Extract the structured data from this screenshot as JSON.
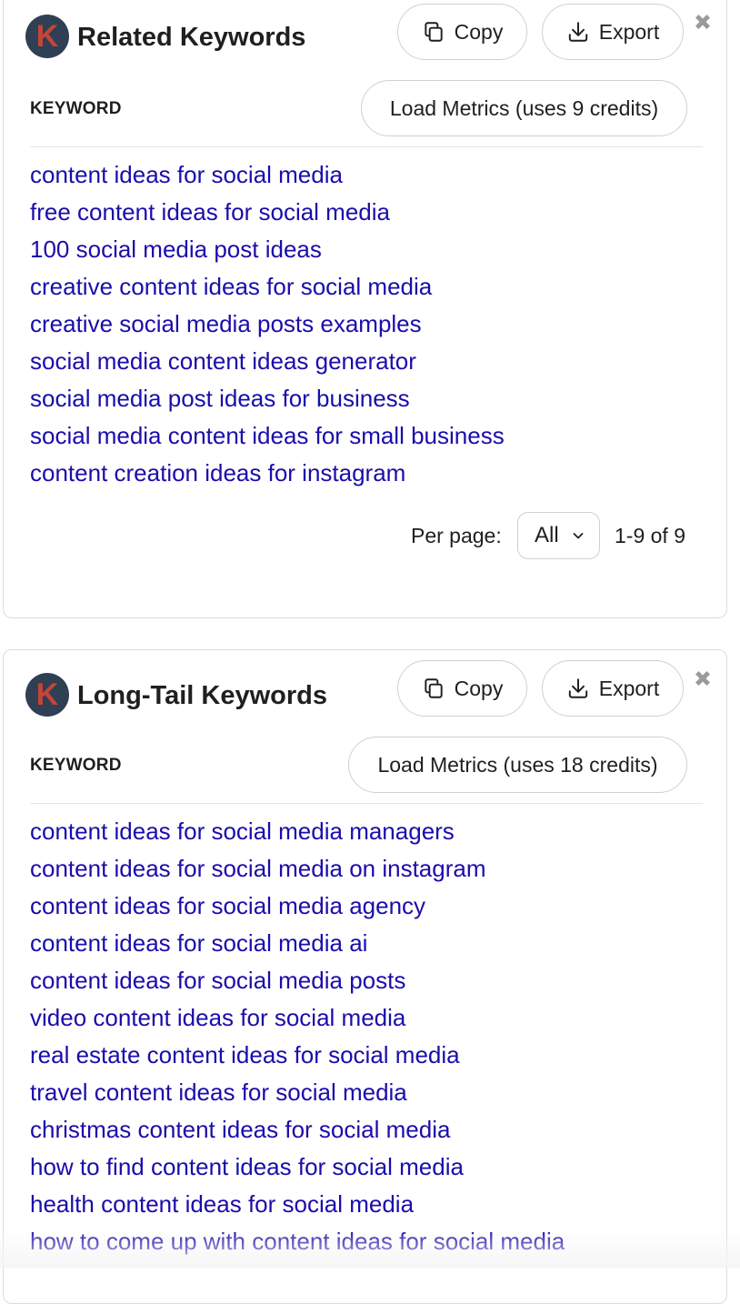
{
  "related": {
    "logo_letter": "K",
    "title": "Related Keywords",
    "copy_label": "Copy",
    "export_label": "Export",
    "column_header": "KEYWORD",
    "load_metrics_label": "Load Metrics (uses 9 credits)",
    "keywords": [
      "content ideas for social media",
      "free content ideas for social media",
      "100 social media post ideas",
      "creative content ideas for social media",
      "creative social media posts examples",
      "social media content ideas generator",
      "social media post ideas for business",
      "social media content ideas for small business",
      "content creation ideas for instagram"
    ],
    "per_page_label": "Per page:",
    "per_page_value": "All",
    "range_text": "1-9 of 9"
  },
  "longtail": {
    "logo_letter": "K",
    "title": "Long-Tail Keywords",
    "copy_label": "Copy",
    "export_label": "Export",
    "column_header": "KEYWORD",
    "load_metrics_label": "Load Metrics (uses 18 credits)",
    "keywords": [
      "content ideas for social media managers",
      "content ideas for social media on instagram",
      "content ideas for social media agency",
      "content ideas for social media ai",
      "content ideas for social media posts",
      "video content ideas for social media",
      "real estate content ideas for social media",
      "travel content ideas for social media",
      "christmas content ideas for social media",
      "how to find content ideas for social media",
      "health content ideas for social media",
      "how to come up with content ideas for social media"
    ]
  },
  "colors": {
    "link": "#1a0dab",
    "logo_bg": "#2f3f54",
    "logo_letter": "#c64436"
  },
  "icons": {
    "copy": "copy-icon",
    "export": "download-icon",
    "close": "close-icon",
    "dropdown": "chevron-down-icon"
  }
}
